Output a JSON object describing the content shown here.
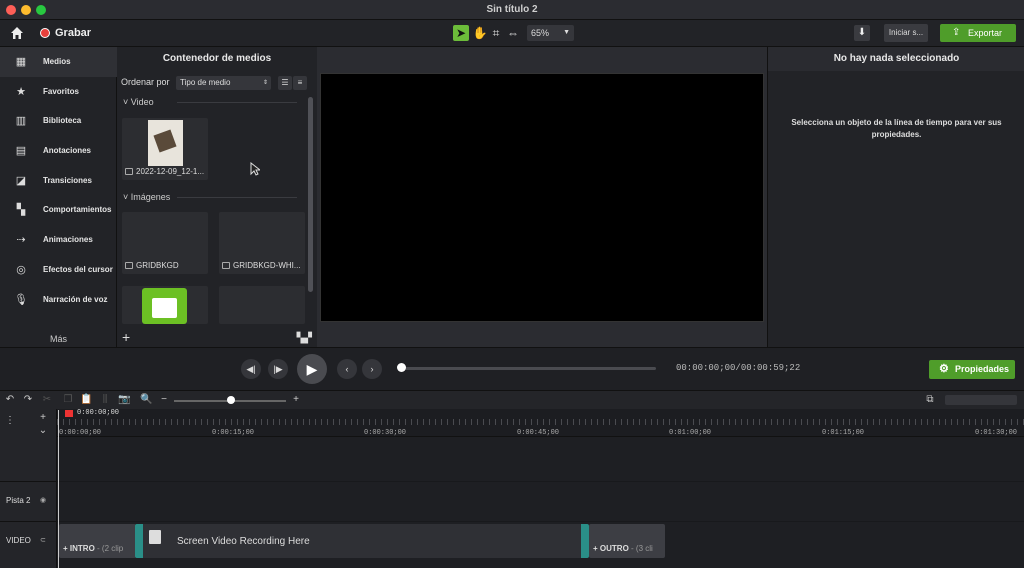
{
  "window": {
    "title": "Sin título 2"
  },
  "toolbar": {
    "record_label": "Grabar",
    "zoom_value": "65%",
    "share_label": "Iniciar s...",
    "export_label": "Exportar"
  },
  "sidebar": {
    "items": [
      {
        "label": "Medios",
        "icon": "film-icon"
      },
      {
        "label": "Favoritos",
        "icon": "star-icon"
      },
      {
        "label": "Biblioteca",
        "icon": "library-icon"
      },
      {
        "label": "Anotaciones",
        "icon": "annotation-icon"
      },
      {
        "label": "Transiciones",
        "icon": "transition-icon"
      },
      {
        "label": "Comportamientos",
        "icon": "behavior-icon"
      },
      {
        "label": "Animaciones",
        "icon": "animation-icon"
      },
      {
        "label": "Efectos del cursor",
        "icon": "cursor-icon"
      },
      {
        "label": "Narración de voz",
        "icon": "microphone-icon"
      }
    ],
    "more_label": "Más"
  },
  "media": {
    "title": "Contenedor de medios",
    "sort_label": "Ordenar por",
    "sort_value": "Tipo de medio",
    "video_section": "Video",
    "images_section": "Imágenes",
    "video_items": [
      {
        "label": "2022-12-09_12-1..."
      }
    ],
    "image_items": [
      {
        "label": "GRIDBKGD"
      },
      {
        "label": "GRIDBKGD-WHI..."
      }
    ]
  },
  "properties": {
    "title": "No hay nada seleccionado",
    "message": "Selecciona un objeto de la línea de tiempo para ver sus propiedades.",
    "button_label": "Propiedades"
  },
  "player": {
    "timecode_current": "00:00:00;00",
    "timecode_total": "00:00:59;22"
  },
  "timeline": {
    "playhead_time": "0:00:00;00",
    "ruler_labels": [
      "0:00:00;00",
      "0:00:15;00",
      "0:00:30;00",
      "0:00:45;00",
      "0:01:00;00",
      "0:01:15;00",
      "0:01:30;00"
    ],
    "tracks": [
      {
        "name": "Pista 2"
      },
      {
        "name": "VIDEO"
      }
    ],
    "clips": {
      "intro_label": "INTRO",
      "intro_sub": "- (2 clip",
      "main_label": "Screen Video Recording Here",
      "outro_label": "OUTRO",
      "outro_sub": "- (3 cli"
    }
  },
  "colors": {
    "accent_green": "#4f9d2a",
    "record_red": "#e8403c",
    "clip_teal": "#2a8f88"
  }
}
